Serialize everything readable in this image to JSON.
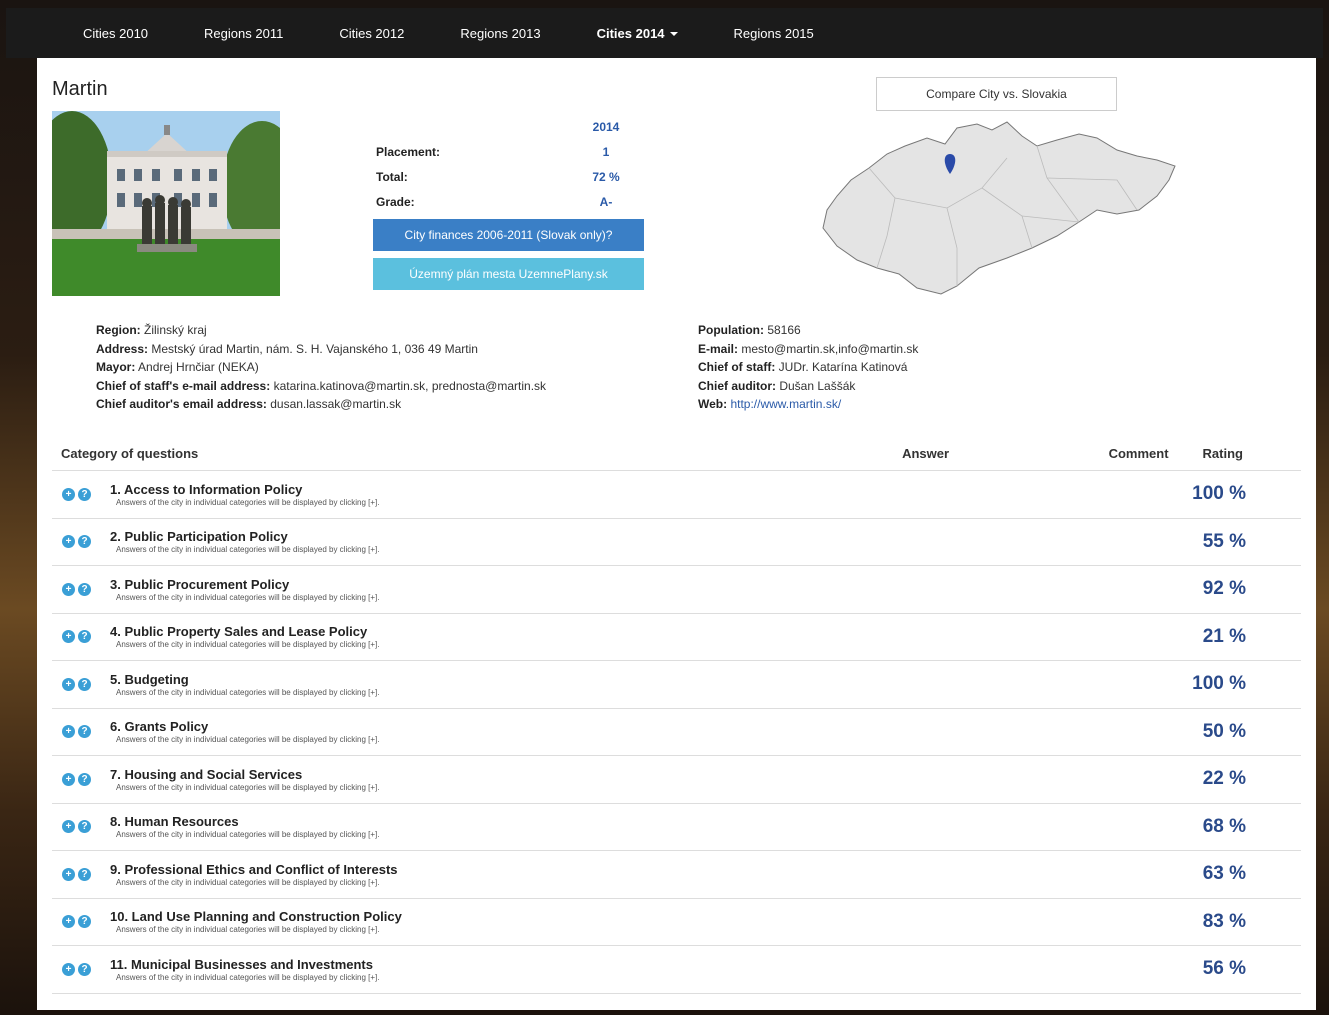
{
  "nav": [
    {
      "label": "Cities 2010",
      "active": false
    },
    {
      "label": "Regions 2011",
      "active": false
    },
    {
      "label": "Cities 2012",
      "active": false
    },
    {
      "label": "Regions 2013",
      "active": false
    },
    {
      "label": "Cities 2014",
      "active": true
    },
    {
      "label": "Regions 2015",
      "active": false
    }
  ],
  "city": {
    "name": "Martin"
  },
  "stats": {
    "year": "2014",
    "placement_label": "Placement:",
    "placement": "1",
    "total_label": "Total:",
    "total": "72 %",
    "grade_label": "Grade:",
    "grade": "A-"
  },
  "buttons": {
    "finances": "City finances 2006-2011 (Slovak only)?",
    "plan": "Územný plán mesta UzemnePlany.sk",
    "compare": "Compare City vs. Slovakia"
  },
  "info_left": [
    {
      "label": "Region:",
      "value": " Žilinský kraj"
    },
    {
      "label": "Address:",
      "value": " Mestský úrad Martin, nám. S. H. Vajanského 1, 036 49 Martin"
    },
    {
      "label": "Mayor:",
      "value": " Andrej Hrnčiar (NEKA)"
    },
    {
      "label": "Chief of staff's e-mail address:",
      "value": " katarina.katinova@martin.sk, prednosta@martin.sk"
    },
    {
      "label": "Chief auditor's email address:",
      "value": " dusan.lassak@martin.sk"
    }
  ],
  "info_right": [
    {
      "label": "Population:",
      "value": " 58166"
    },
    {
      "label": "E-mail:",
      "value": " mesto@martin.sk,info@martin.sk"
    },
    {
      "label": "Chief of staff:",
      "value": " JUDr. Katarína Katinová"
    },
    {
      "label": "Chief auditor:",
      "value": " Dušan Laššák"
    }
  ],
  "web": {
    "label": "Web:",
    "url": "http://www.martin.sk/"
  },
  "table": {
    "headers": {
      "category": "Category of questions",
      "answer": "Answer",
      "comment": "Comment",
      "rating": "Rating"
    },
    "subtext": "Answers of the city in individual categories will be displayed by clicking [+].",
    "rows": [
      {
        "title": "1. Access to Information Policy",
        "rating": "100 %"
      },
      {
        "title": "2. Public Participation Policy",
        "rating": "55 %"
      },
      {
        "title": "3. Public Procurement Policy",
        "rating": "92 %"
      },
      {
        "title": "4. Public Property Sales and Lease Policy",
        "rating": "21 %"
      },
      {
        "title": "5. Budgeting",
        "rating": "100 %"
      },
      {
        "title": "6. Grants Policy",
        "rating": "50 %"
      },
      {
        "title": "7. Housing and Social Services",
        "rating": "22 %"
      },
      {
        "title": "8. Human Resources",
        "rating": "68 %"
      },
      {
        "title": "9. Professional Ethics and Conflict of Interests",
        "rating": "63 %"
      },
      {
        "title": "10. Land Use Planning and Construction Policy",
        "rating": "83 %"
      },
      {
        "title": "11. Municipal Businesses and Investments",
        "rating": "56 %"
      }
    ]
  },
  "colors": {
    "nav_bg": "#1b1b1b",
    "primary": "#3a7fc6",
    "info": "#5bc0de",
    "rating": "#2a4a8a",
    "marker": "#2a4aa8"
  },
  "icons": {
    "expand": "plus-circle-icon",
    "help": "question-circle-icon",
    "map_marker": "map-marker-icon"
  }
}
